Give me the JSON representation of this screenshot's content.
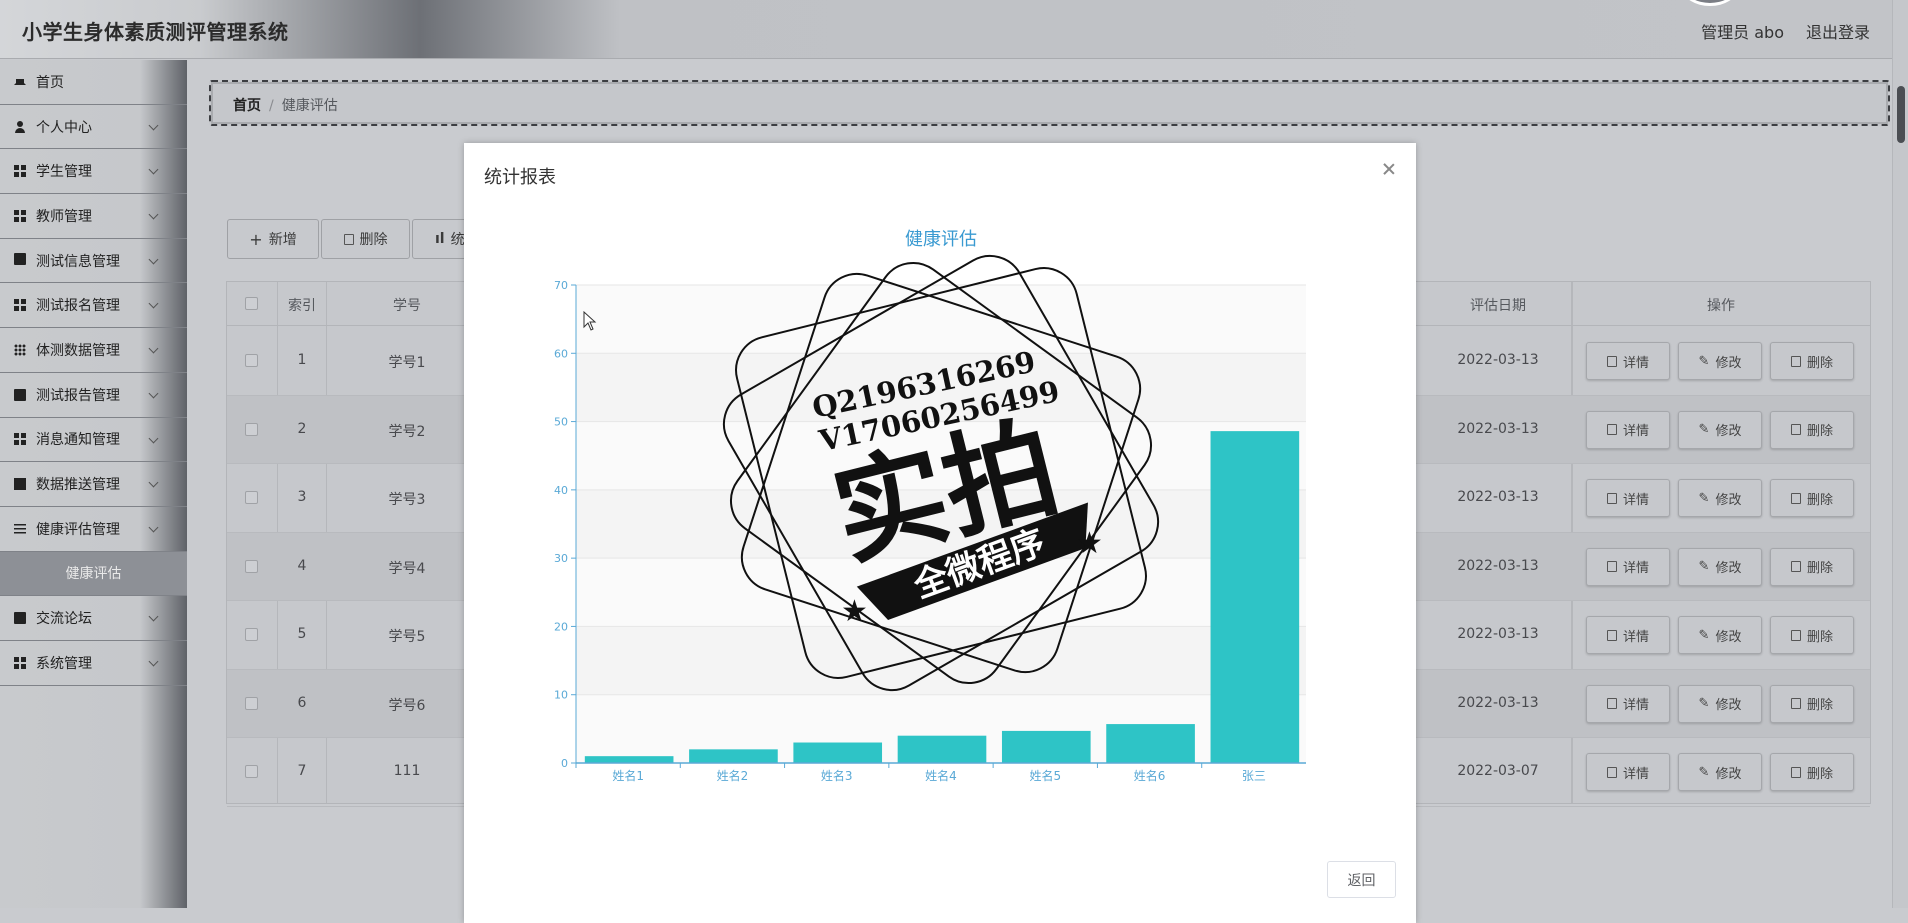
{
  "header": {
    "title": "小学生身体素质测评管理系统",
    "user": "管理员 abo",
    "logout": "退出登录"
  },
  "sidebar": {
    "items": [
      {
        "label": "首页",
        "icon": "home-icon"
      },
      {
        "label": "个人中心",
        "icon": "user-icon"
      },
      {
        "label": "学生管理",
        "icon": "grid-icon"
      },
      {
        "label": "教师管理",
        "icon": "grid-icon"
      },
      {
        "label": "测试信息管理",
        "icon": "monitor-icon"
      },
      {
        "label": "测试报名管理",
        "icon": "grid-icon"
      },
      {
        "label": "体测数据管理",
        "icon": "apps-icon"
      },
      {
        "label": "测试报告管理",
        "icon": "clipboard-icon"
      },
      {
        "label": "消息通知管理",
        "icon": "grid-icon"
      },
      {
        "label": "数据推送管理",
        "icon": "checkbox-icon"
      },
      {
        "label": "健康评估管理",
        "icon": "sliders-icon"
      },
      {
        "label": "交流论坛",
        "icon": "chat-icon"
      },
      {
        "label": "系统管理",
        "icon": "grid-icon"
      }
    ],
    "sub_item": "健康评估"
  },
  "breadcrumb": {
    "home": "首页",
    "separator": "/",
    "current": "健康评估"
  },
  "toolbar": {
    "add": "新增",
    "delete": "删除",
    "stats": "统"
  },
  "table": {
    "headers": {
      "index": "索引",
      "student_no": "学号",
      "date": "评估日期",
      "actions": "操作"
    },
    "rows": [
      {
        "index": "1",
        "student_no": "学号1",
        "date": "2022-03-13"
      },
      {
        "index": "2",
        "student_no": "学号2",
        "date": "2022-03-13"
      },
      {
        "index": "3",
        "student_no": "学号3",
        "date": "2022-03-13"
      },
      {
        "index": "4",
        "student_no": "学号4",
        "date": "2022-03-13"
      },
      {
        "index": "5",
        "student_no": "学号5",
        "date": "2022-03-13"
      },
      {
        "index": "6",
        "student_no": "学号6",
        "date": "2022-03-13"
      },
      {
        "index": "7",
        "student_no": "111",
        "date": "2022-03-07"
      }
    ],
    "action_labels": {
      "detail": "详情",
      "edit": "修改",
      "delete": "删除"
    }
  },
  "modal": {
    "title": "统计报表",
    "back": "返回",
    "watermark": {
      "line1": "Q2196316269",
      "line2": "V17060256499",
      "big": "实拍",
      "banner": "全微程序"
    }
  },
  "chart_data": {
    "type": "bar",
    "title": "健康评估",
    "categories": [
      "姓名1",
      "姓名2",
      "姓名3",
      "姓名4",
      "姓名5",
      "姓名6",
      "张三"
    ],
    "values": [
      1,
      2,
      3,
      4,
      4.7,
      5.7,
      48.6
    ],
    "ylim": [
      0,
      70
    ],
    "yticks": [
      0,
      10,
      20,
      30,
      40,
      50,
      60,
      70
    ],
    "xlabel": "",
    "ylabel": "",
    "bar_color": "#2ec4c6",
    "axis_color": "#5aa9d6",
    "title_color": "#3a9ad1"
  }
}
